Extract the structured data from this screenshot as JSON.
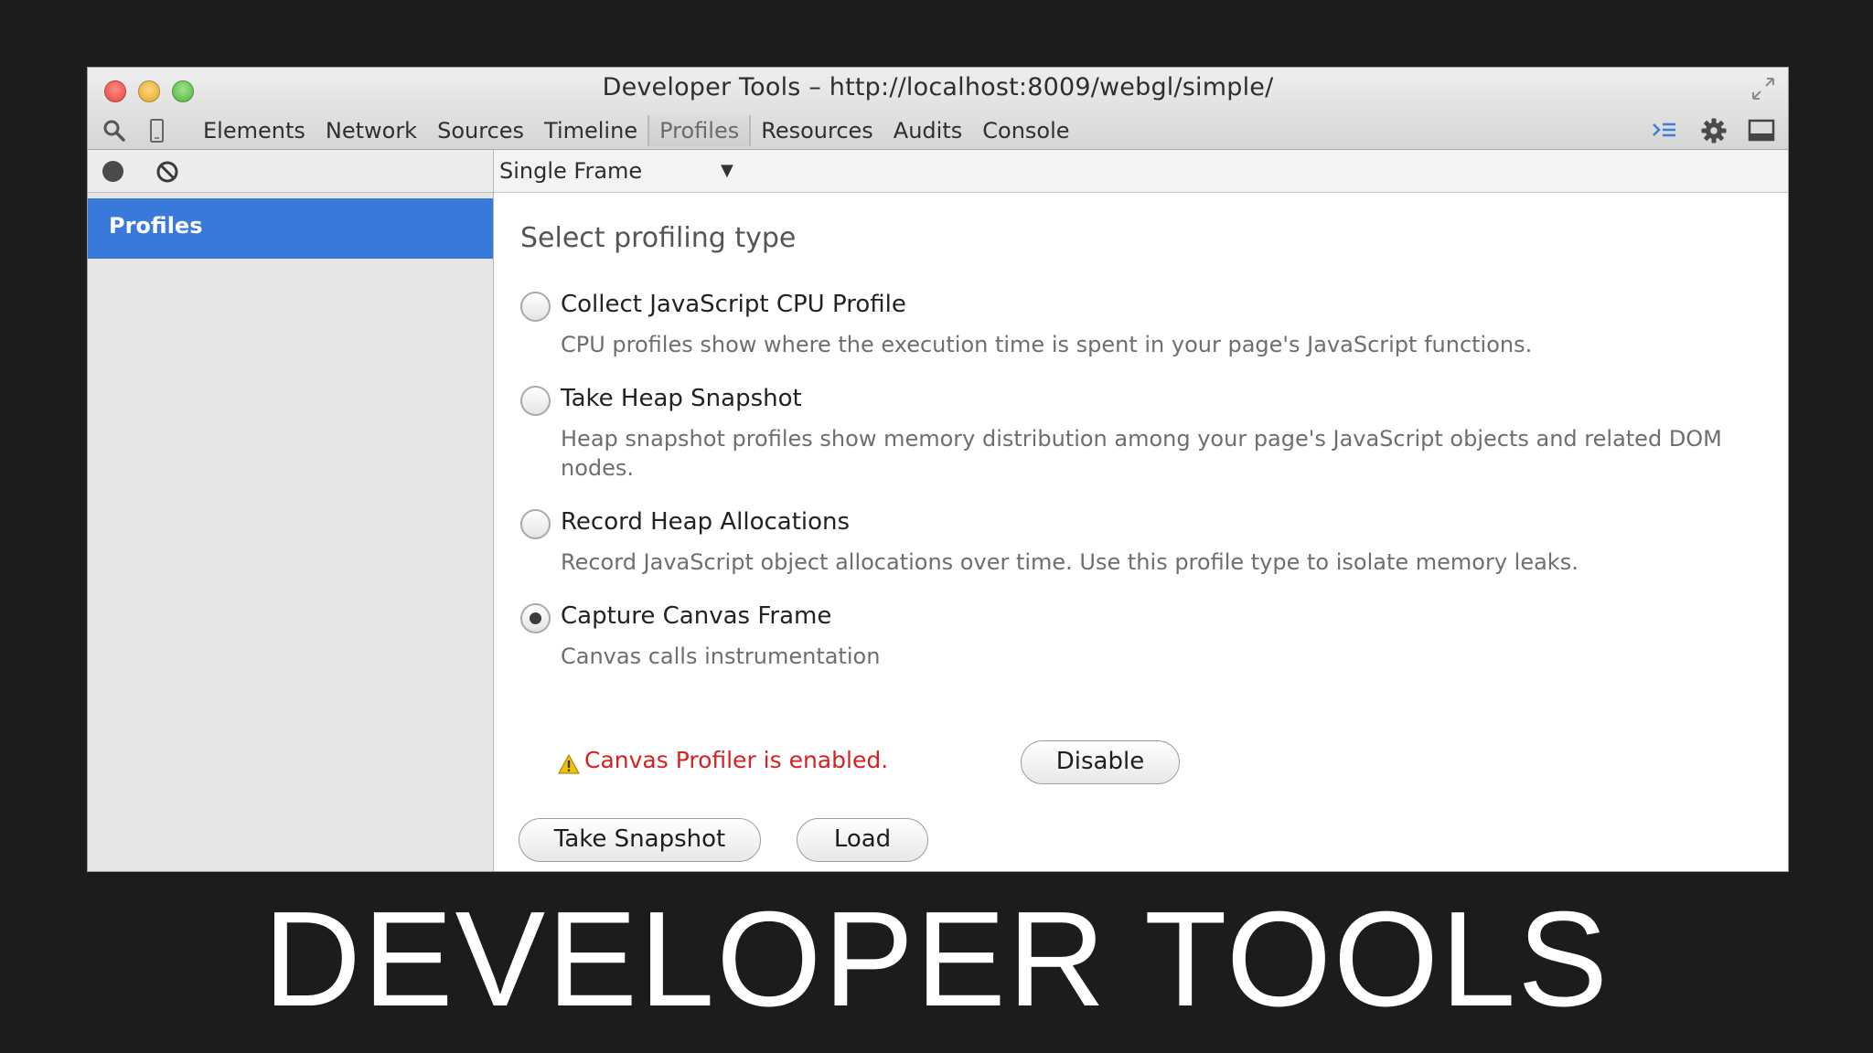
{
  "window": {
    "title": "Developer Tools – http://localhost:8009/webgl/simple/"
  },
  "toolbar": {
    "tabs": [
      {
        "label": "Elements",
        "active": false
      },
      {
        "label": "Network",
        "active": false
      },
      {
        "label": "Sources",
        "active": false
      },
      {
        "label": "Timeline",
        "active": false
      },
      {
        "label": "Profiles",
        "active": true
      },
      {
        "label": "Resources",
        "active": false
      },
      {
        "label": "Audits",
        "active": false
      },
      {
        "label": "Console",
        "active": false
      }
    ]
  },
  "sidebar": {
    "items": [
      {
        "label": "Profiles",
        "selected": true
      }
    ]
  },
  "main": {
    "frame_select": "Single Frame",
    "heading": "Select profiling type",
    "options": [
      {
        "label": "Collect JavaScript CPU Profile",
        "desc": "CPU profiles show where the execution time is spent in your page's JavaScript functions.",
        "checked": false
      },
      {
        "label": "Take Heap Snapshot",
        "desc": "Heap snapshot profiles show memory distribution among your page's JavaScript objects and related DOM nodes.",
        "checked": false
      },
      {
        "label": "Record Heap Allocations",
        "desc": "Record JavaScript object allocations over time. Use this profile type to isolate memory leaks.",
        "checked": false
      },
      {
        "label": "Capture Canvas Frame",
        "desc": "Canvas calls instrumentation",
        "checked": true
      }
    ],
    "warning": "Canvas Profiler is enabled.",
    "disable_label": "Disable",
    "take_snapshot_label": "Take Snapshot",
    "load_label": "Load"
  },
  "banner": "DEVELOPER TOOLS",
  "colors": {
    "selection": "#3879d9",
    "warning": "#d92020",
    "background": "#1c1c1d"
  }
}
